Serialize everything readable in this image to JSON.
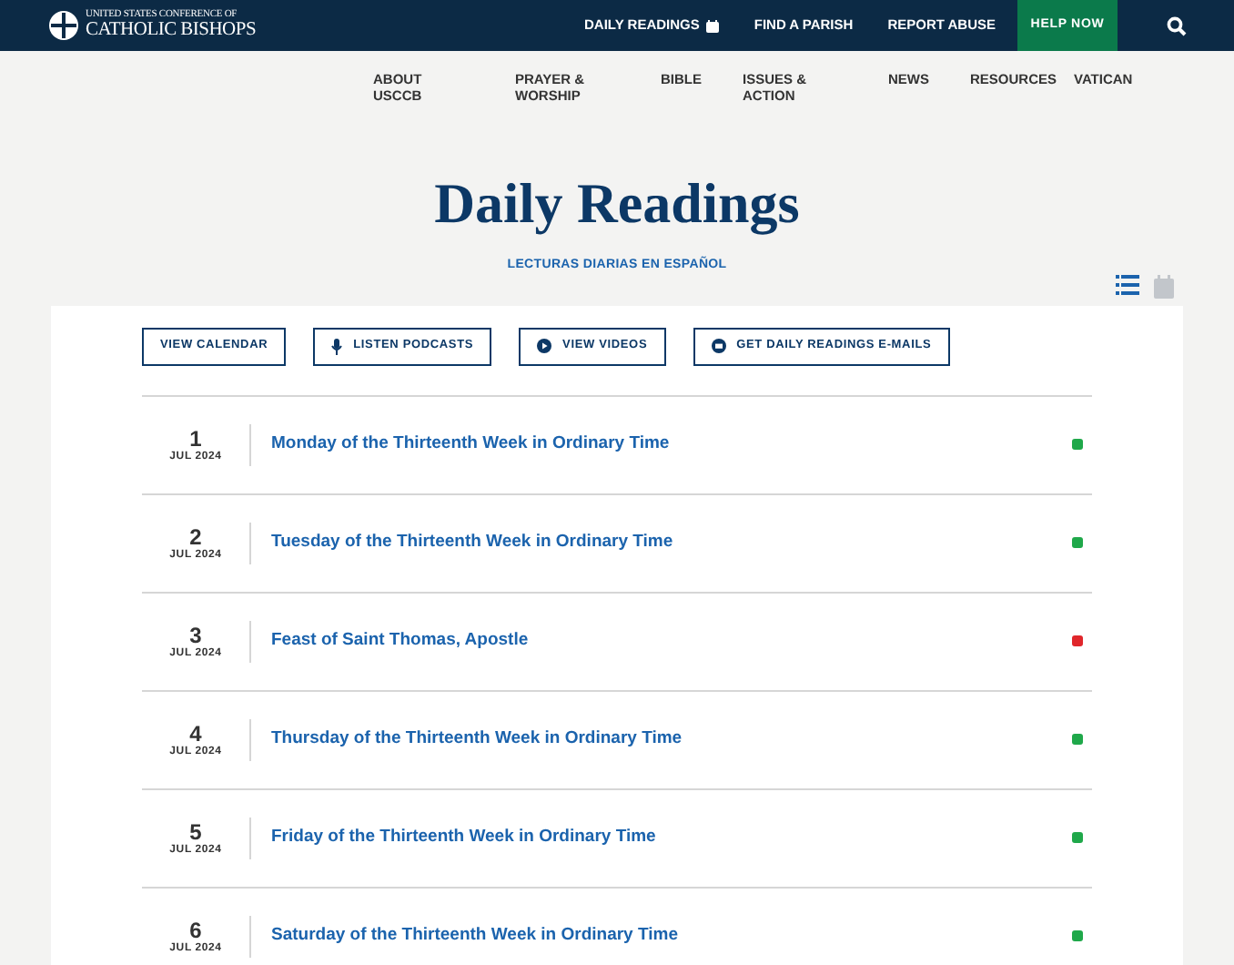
{
  "header": {
    "logo_line_1": "UNITED STATES CONFERENCE OF",
    "logo_line_2": "CATHOLIC BISHOPS",
    "links": [
      "DAILY READINGS",
      "FIND A PARISH",
      "REPORT ABUSE"
    ],
    "help_button": "HELP NOW"
  },
  "nav": [
    "ABOUT USCCB",
    "PRAYER & WORSHIP",
    "BIBLE",
    "ISSUES & ACTION",
    "NEWS",
    "RESOURCES",
    "VATICAN"
  ],
  "title": "Daily Readings",
  "spanish_link": "LECTURAS DIARIAS EN ESPAÑOL",
  "view_toggle": [
    {
      "kind": "list",
      "selected": true
    },
    {
      "kind": "calendar",
      "selected": false
    }
  ],
  "actions": [
    {
      "kind": "none",
      "label": "VIEW CALENDAR"
    },
    {
      "kind": "mic",
      "label": "LISTEN PODCASTS"
    },
    {
      "kind": "play",
      "label": "VIEW VIDEOS"
    },
    {
      "kind": "mail",
      "label": "GET DAILY READINGS E-MAILS"
    }
  ],
  "readings": [
    {
      "day": "1",
      "month": "JUL 2024",
      "title": "Monday of the Thirteenth Week in Ordinary Time",
      "color": "#1fa84a"
    },
    {
      "day": "2",
      "month": "JUL 2024",
      "title": "Tuesday of the Thirteenth Week in Ordinary Time",
      "color": "#1fa84a"
    },
    {
      "day": "3",
      "month": "JUL 2024",
      "title": "Feast of Saint Thomas, Apostle",
      "color": "#e0262b"
    },
    {
      "day": "4",
      "month": "JUL 2024",
      "title": "Thursday of the Thirteenth Week in Ordinary Time",
      "color": "#1fa84a"
    },
    {
      "day": "5",
      "month": "JUL 2024",
      "title": "Friday of the Thirteenth Week in Ordinary Time",
      "color": "#1fa84a"
    },
    {
      "day": "6",
      "month": "JUL 2024",
      "title": "Saturday of the Thirteenth Week in Ordinary Time",
      "color": "#1fa84a"
    }
  ]
}
